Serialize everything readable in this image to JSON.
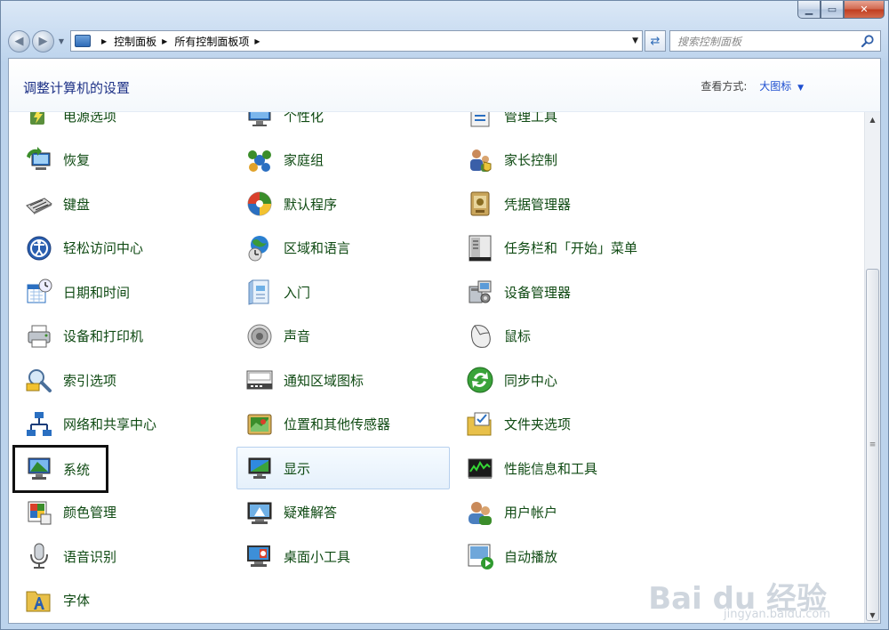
{
  "breadcrumb": [
    "控制面板",
    "所有控制面板项"
  ],
  "search_placeholder": "搜索控制面板",
  "page_title": "调整计算机的设置",
  "view_by_label": "查看方式:",
  "view_by_value": "大图标",
  "watermark": "Bai du 经验",
  "watermark_sub": "jingyan.baidu.com",
  "items": [
    {
      "label": "电源选项",
      "icon": "power-options-icon"
    },
    {
      "label": "个性化",
      "icon": "personalization-icon"
    },
    {
      "label": "管理工具",
      "icon": "admin-tools-icon"
    },
    {
      "label": "恢复",
      "icon": "recovery-icon"
    },
    {
      "label": "家庭组",
      "icon": "homegroup-icon"
    },
    {
      "label": "家长控制",
      "icon": "parental-controls-icon"
    },
    {
      "label": "键盘",
      "icon": "keyboard-icon"
    },
    {
      "label": "默认程序",
      "icon": "default-programs-icon"
    },
    {
      "label": "凭据管理器",
      "icon": "credential-manager-icon"
    },
    {
      "label": "轻松访问中心",
      "icon": "ease-of-access-icon"
    },
    {
      "label": "区域和语言",
      "icon": "region-language-icon"
    },
    {
      "label": "任务栏和「开始」菜单",
      "icon": "taskbar-icon"
    },
    {
      "label": "日期和时间",
      "icon": "date-time-icon"
    },
    {
      "label": "入门",
      "icon": "getting-started-icon"
    },
    {
      "label": "设备管理器",
      "icon": "device-manager-icon"
    },
    {
      "label": "设备和打印机",
      "icon": "devices-printers-icon"
    },
    {
      "label": "声音",
      "icon": "sound-icon"
    },
    {
      "label": "鼠标",
      "icon": "mouse-icon"
    },
    {
      "label": "索引选项",
      "icon": "indexing-icon"
    },
    {
      "label": "通知区域图标",
      "icon": "notification-area-icon"
    },
    {
      "label": "同步中心",
      "icon": "sync-center-icon"
    },
    {
      "label": "网络和共享中心",
      "icon": "network-sharing-icon"
    },
    {
      "label": "位置和其他传感器",
      "icon": "location-sensors-icon"
    },
    {
      "label": "文件夹选项",
      "icon": "folder-options-icon"
    },
    {
      "label": "系统",
      "icon": "system-icon"
    },
    {
      "label": "显示",
      "icon": "display-icon"
    },
    {
      "label": "性能信息和工具",
      "icon": "performance-icon"
    },
    {
      "label": "颜色管理",
      "icon": "color-management-icon"
    },
    {
      "label": "疑难解答",
      "icon": "troubleshooting-icon"
    },
    {
      "label": "用户帐户",
      "icon": "user-accounts-icon"
    },
    {
      "label": "语音识别",
      "icon": "speech-recognition-icon"
    },
    {
      "label": "桌面小工具",
      "icon": "desktop-gadgets-icon"
    },
    {
      "label": "自动播放",
      "icon": "autoplay-icon"
    },
    {
      "label": "字体",
      "icon": "fonts-icon"
    }
  ]
}
